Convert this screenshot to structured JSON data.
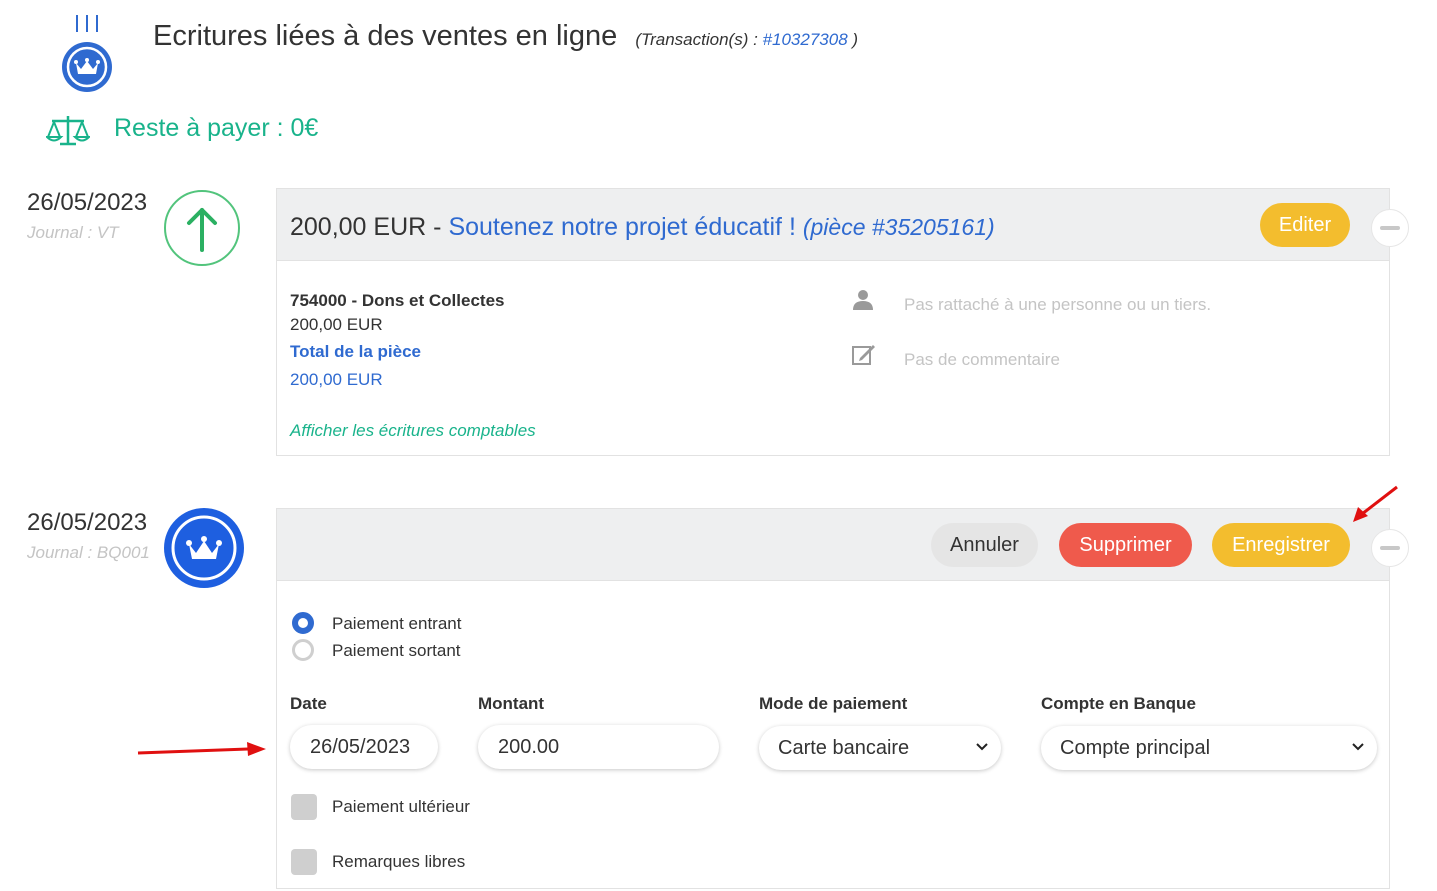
{
  "header": {
    "title": "Ecritures liées à des ventes en ligne",
    "transactions_prefix": "(Transaction(s) :",
    "transaction_link": "#10327308",
    "transactions_suffix": ")",
    "logo_icon": "crown-badge-icon"
  },
  "balance": {
    "icon": "scales-icon",
    "text": "Reste à payer : 0€"
  },
  "entries": [
    {
      "date": "26/05/2023",
      "journal": "Journal : VT",
      "icon": "arrow-up-icon",
      "amount": "200,00 EUR",
      "separator": "-",
      "label": "Soutenez notre projet éducatif !",
      "piece": "(pièce #35205161)",
      "edit_label": "Editer",
      "account": "754000 - Dons et Collectes",
      "account_amount": "200,00 EUR",
      "total_label": "Total de la pièce",
      "total_amount": "200,00 EUR",
      "show_entries_link": "Afficher les écritures comptables",
      "person_text": "Pas rattaché à une personne ou un tiers.",
      "comment_text": "Pas de commentaire"
    },
    {
      "date": "26/05/2023",
      "journal": "Journal : BQ001",
      "icon": "crown-icon",
      "cancel_label": "Annuler",
      "delete_label": "Supprimer",
      "save_label": "Enregistrer",
      "radio_in": "Paiement entrant",
      "radio_out": "Paiement sortant",
      "date_label": "Date",
      "date_value": "26/05/2023",
      "amount_label": "Montant",
      "amount_value": "200.00",
      "mode_label": "Mode de paiement",
      "mode_value": "Carte bancaire",
      "account_label": "Compte en Banque",
      "account_value": "Compte principal",
      "later_label": "Paiement ultérieur",
      "remarks_label": "Remarques libres"
    }
  ],
  "colors": {
    "accent_blue": "#2f6ad0",
    "green": "#19b38b",
    "yellow_button": "#f3bd2e",
    "red_button": "#ef5a4c",
    "annotation_red": "#e01010"
  }
}
